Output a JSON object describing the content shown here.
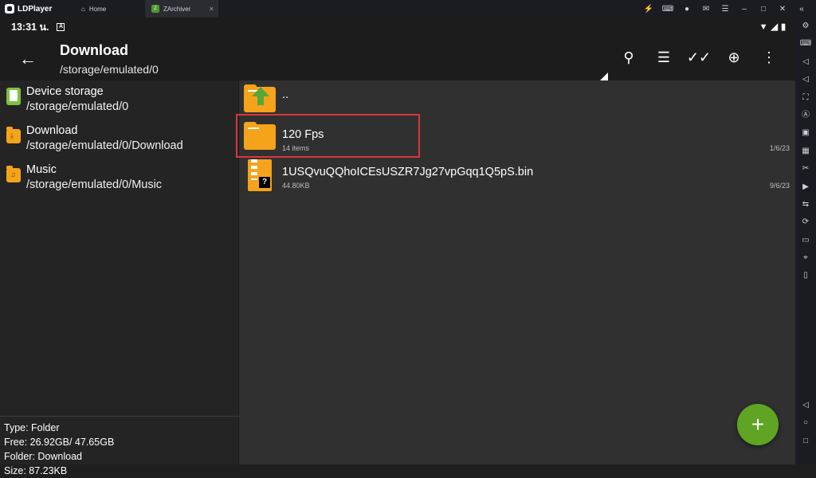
{
  "emulator": {
    "brand": "LDPlayer",
    "tabs": [
      {
        "label": "Home",
        "icon": "home-icon"
      },
      {
        "label": "ZArchiver",
        "icon": "zarchiver-icon"
      }
    ],
    "window_controls": [
      "bolt-icon",
      "gamepad-icon",
      "account-icon",
      "mail-icon",
      "menu-icon",
      "minimize-icon",
      "maximize-icon",
      "close-icon",
      "collapse-icon"
    ],
    "side_tools": [
      "settings-icon",
      "keyboard-icon",
      "volume-up-icon",
      "volume-down-icon",
      "screenshot-icon",
      "multi-instance-icon",
      "video-icon",
      "apk-icon",
      "cut-icon",
      "record-icon",
      "sync-icon",
      "rotate-icon",
      "folder-icon",
      "location-icon",
      "shake-icon"
    ],
    "nav_buttons": [
      "back-icon",
      "home-icon",
      "recent-icon"
    ]
  },
  "status": {
    "time": "13:31 น.",
    "indicator": "A"
  },
  "toolbar": {
    "back": "←",
    "title": "Download",
    "subtitle": "/storage/emulated/0"
  },
  "locations": [
    {
      "name": "Device storage",
      "path": "/storage/emulated/0",
      "icon": "device-storage-icon"
    },
    {
      "name": "Download",
      "path": "/storage/emulated/0/Download",
      "icon": "download-folder-icon"
    },
    {
      "name": "Music",
      "path": "/storage/emulated/0/Music",
      "icon": "music-folder-icon"
    }
  ],
  "info": {
    "type": "Type: Folder",
    "free": "Free: 26.92GB/ 47.65GB",
    "folder": "Folder: Download",
    "size": "Size: 87.23KB"
  },
  "files": [
    {
      "name": "..",
      "meta": "",
      "date": ""
    },
    {
      "name": "120 Fps",
      "meta": "14 items",
      "date": "1/6/23"
    },
    {
      "name": "1USQvuQQhoICEsUSZR7Jg27vpGqq1Q5pS.bin",
      "meta": "44.80KB",
      "date": "9/6/23"
    }
  ],
  "fab_label": "+"
}
